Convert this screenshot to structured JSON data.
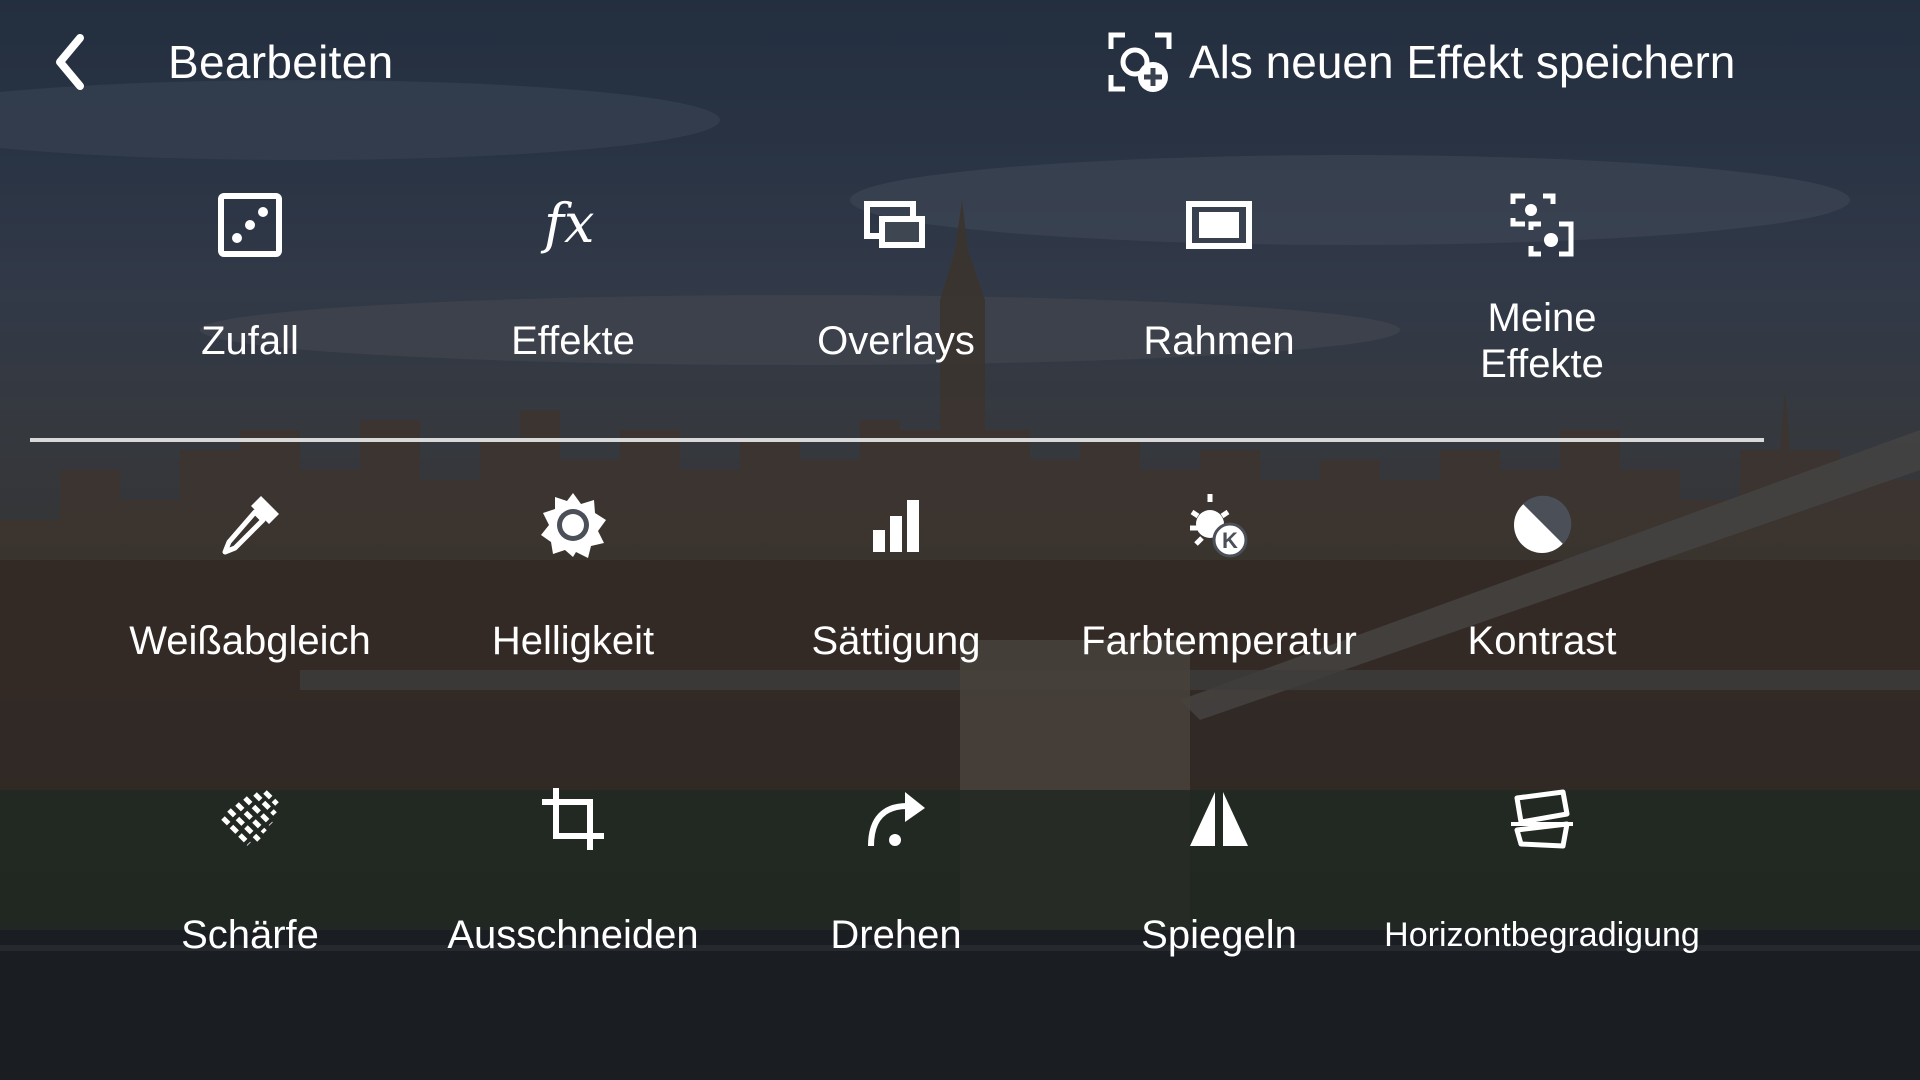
{
  "header": {
    "title": "Bearbeiten",
    "save_label": "Als neuen Effekt speichern"
  },
  "presets": [
    {
      "label": "Zufall",
      "icon": "dice-icon"
    },
    {
      "label": "Effekte",
      "icon": "fx-icon"
    },
    {
      "label": "Overlays",
      "icon": "overlays-icon"
    },
    {
      "label": "Rahmen",
      "icon": "frame-icon"
    },
    {
      "label": "Meine\nEffekte",
      "icon": "my-effects-icon"
    }
  ],
  "adjustments": [
    {
      "label": "Weißabgleich",
      "icon": "eyedropper-icon"
    },
    {
      "label": "Helligkeit",
      "icon": "brightness-icon"
    },
    {
      "label": "Sättigung",
      "icon": "saturation-bars-icon"
    },
    {
      "label": "Farbtemperatur",
      "icon": "color-temperature-icon"
    },
    {
      "label": "Kontrast",
      "icon": "contrast-icon"
    }
  ],
  "transforms": [
    {
      "label": "Schärfe",
      "icon": "sharpness-icon"
    },
    {
      "label": "Ausschneiden",
      "icon": "crop-icon"
    },
    {
      "label": "Drehen",
      "icon": "rotate-icon"
    },
    {
      "label": "Spiegeln",
      "icon": "mirror-icon"
    },
    {
      "label": "Horizontbegradigung",
      "icon": "straighten-icon"
    }
  ],
  "colors": {
    "text": "#ffffff",
    "divider": "#d9d9d9"
  }
}
